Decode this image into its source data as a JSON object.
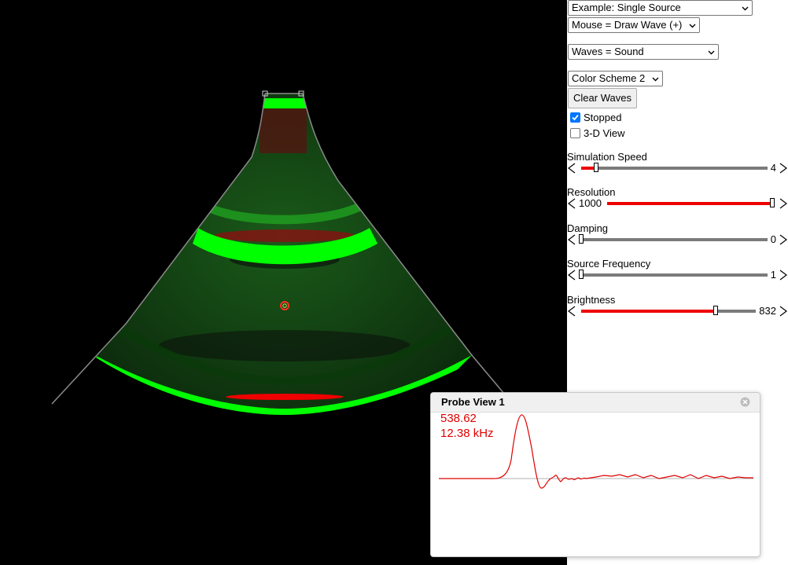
{
  "controls": {
    "example_select": "Example: Single Source",
    "mouse_select": "Mouse = Draw Wave (+)",
    "waves_select": "Waves = Sound",
    "color_select": "Color Scheme 2",
    "clear_button": "Clear Waves",
    "stopped_label": "Stopped",
    "stopped_checked": true,
    "view3d_label": "3-D View",
    "view3d_checked": false
  },
  "sliders": [
    {
      "label": "Simulation Speed",
      "value": "4",
      "fraction": 0.08,
      "active": true
    },
    {
      "label": "Resolution",
      "value": "1000",
      "fraction": 0.99,
      "active": true
    },
    {
      "label": "Damping",
      "value": "0",
      "fraction": 0.0,
      "active": false
    },
    {
      "label": "Source Frequency",
      "value": "1",
      "fraction": 0.0,
      "active": false
    },
    {
      "label": "Brightness",
      "value": "832",
      "fraction": 0.77,
      "active": true
    }
  ],
  "probe": {
    "title": "Probe View 1",
    "value": "538.62",
    "frequency": "12.38 kHz"
  },
  "colors": {
    "wave_positive": "#00ff00",
    "wave_negative": "#ee0000",
    "probe_trace": "#e00000",
    "slider_active": "#ee0000",
    "slider_inactive": "#7b7b7b"
  }
}
